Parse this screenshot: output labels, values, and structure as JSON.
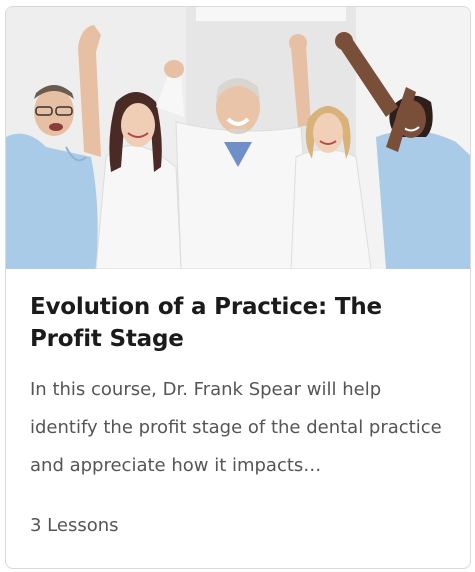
{
  "card": {
    "image_alt": "Group of cheering dental professionals in white coats and scrubs",
    "title": "Evolution of a Practice: The Profit Stage",
    "description": "In this course, Dr. Frank Spear will help identify the profit stage of the dental practice and appreciate how it impacts…",
    "lessons": "3 Lessons"
  },
  "colors": {
    "title": "#1b1b1b",
    "text": "#555555",
    "border": "#d9d9d9",
    "scrub_blue": "#a9cbe8",
    "coat_white": "#f7f7f7"
  }
}
